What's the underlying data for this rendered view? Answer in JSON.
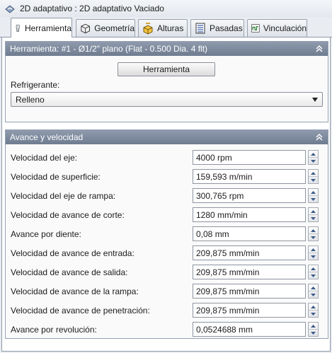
{
  "window": {
    "title": "2D adaptativo : 2D adaptativo Vaciado"
  },
  "tabs": [
    {
      "label": "Herramienta",
      "icon": "tool-icon",
      "active": true
    },
    {
      "label": "Geometría",
      "icon": "geometry-icon",
      "active": false
    },
    {
      "label": "Alturas",
      "icon": "heights-icon",
      "active": false
    },
    {
      "label": "Pasadas",
      "icon": "passes-icon",
      "active": false
    },
    {
      "label": "Vinculación",
      "icon": "linking-icon",
      "active": false
    }
  ],
  "tool_group": {
    "header": "Herramienta: #1 - Ø1/2\" plano (Flat - 0.500 Dia. 4 flt)",
    "button_label": "Herramienta",
    "coolant_label": "Refrigerante:",
    "coolant_value": "Relleno"
  },
  "feed_group": {
    "header": "Avance y velocidad",
    "rows": [
      {
        "label": "Velocidad del eje:",
        "value": "4000 rpm"
      },
      {
        "label": "Velocidad de superficie:",
        "value": "159,593 m/min"
      },
      {
        "label": "Velocidad del eje de rampa:",
        "value": "300,765 rpm"
      },
      {
        "label": "Velocidad de avance de corte:",
        "value": "1280 mm/min"
      },
      {
        "label": "Avance por diente:",
        "value": "0,08 mm"
      },
      {
        "label": "Velocidad de avance de entrada:",
        "value": "209,875 mm/min"
      },
      {
        "label": "Velocidad de avance de salida:",
        "value": "209,875 mm/min"
      },
      {
        "label": "Velocidad de avance de la rampa:",
        "value": "209,875 mm/min"
      },
      {
        "label": "Velocidad de avance de penetración:",
        "value": "209,875 mm/min"
      },
      {
        "label": "Avance por revolución:",
        "value": "0,0524688 mm"
      }
    ]
  },
  "colors": {
    "group_header": "#7c889b",
    "window_bg": "#e9ecf1",
    "panel_bg": "#fafafa"
  }
}
